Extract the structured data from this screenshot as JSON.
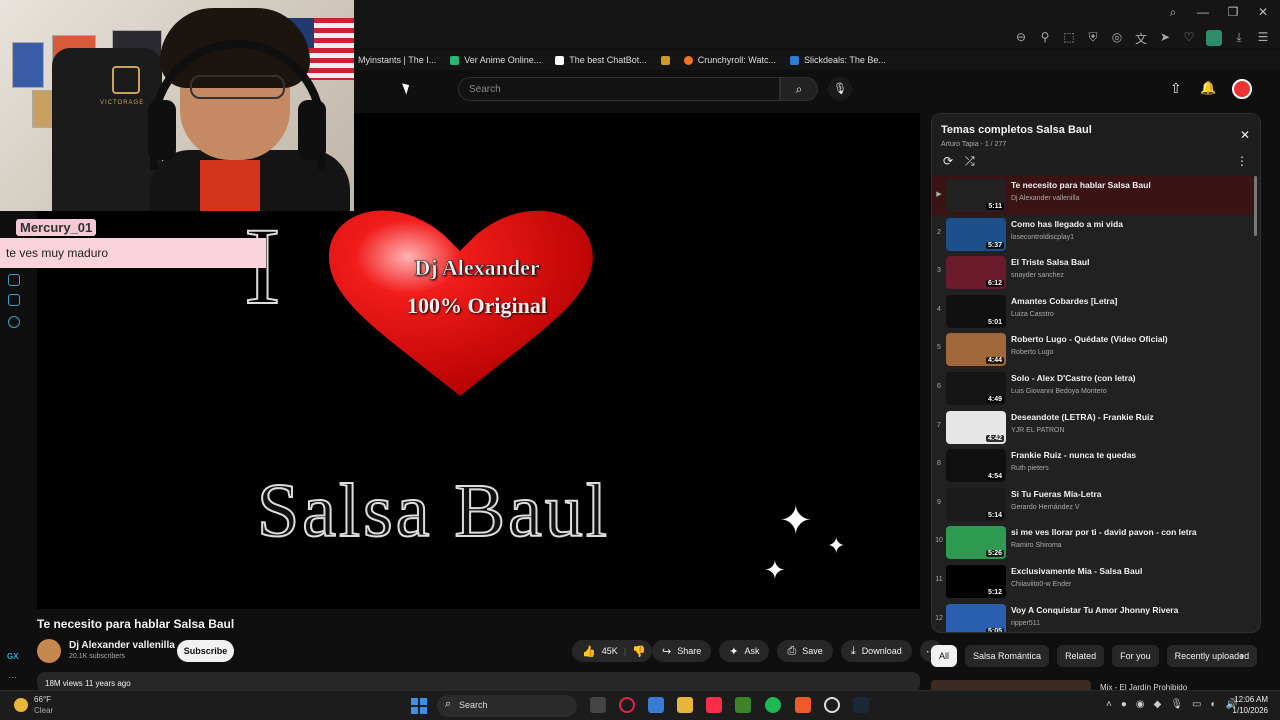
{
  "browser": {
    "bookmarks": [
      {
        "label": "Myinstants | The I...",
        "color": "#7a7a7a"
      },
      {
        "label": "Ver Anime Online...",
        "color": "#2bb673"
      },
      {
        "label": "The best ChatBot...",
        "color": "#ffffff"
      },
      {
        "label": "",
        "color": "#cf9a27"
      },
      {
        "label": "Crunchyroll: Watc...",
        "color": "#f47521"
      },
      {
        "label": "Slickdeals: The Be...",
        "color": "#2f7bd6"
      }
    ]
  },
  "overlay": {
    "chat_user": "Mercury_01",
    "chat_message": "te ves muy maduro",
    "chair_brand": "VICTORAGE"
  },
  "masthead": {
    "search_placeholder": "Search"
  },
  "player": {
    "big_letter": "I",
    "heart_line1": "Dj Alexander",
    "heart_line2": "100% Original",
    "main_text": "Salsa Baul"
  },
  "video": {
    "title": "Te necesito para hablar Salsa Baul",
    "channel": "Dj Alexander vallenilla",
    "subscribers": "20.1K subscribers",
    "subscribe_label": "Subscribe",
    "likes": "45K",
    "share_label": "Share",
    "ask_label": "Ask",
    "save_label": "Save",
    "download_label": "Download",
    "views_date": "18M views  11 years ago"
  },
  "playlist": {
    "title": "Temas completos Salsa Baul",
    "subtitle": "Arturo Tapia - 1 / 277",
    "items": [
      {
        "idx": "▶",
        "title": "Te necesito para hablar Salsa Baul",
        "channel": "Dj Alexander vallenilla",
        "duration": "5:11",
        "thumb": "#222"
      },
      {
        "idx": "2",
        "title": "Como has llegado a mi vida",
        "channel": "losecontroldiscplay1",
        "duration": "5:37",
        "thumb": "#1d4f8a"
      },
      {
        "idx": "3",
        "title": "El Triste Salsa Baul",
        "channel": "snayder sanchez",
        "duration": "6:12",
        "thumb": "#6a1a2a"
      },
      {
        "idx": "4",
        "title": "Amantes Cobardes [Letra]",
        "channel": "Luiza Casstro",
        "duration": "5:01",
        "thumb": "#111"
      },
      {
        "idx": "5",
        "title": "Roberto Lugo - Quédate (Video Oficial)",
        "channel": "Roberto Lugo",
        "duration": "4:44",
        "thumb": "#a0683a"
      },
      {
        "idx": "6",
        "title": "Solo - Alex D'Castro (con letra)",
        "channel": "Luis Giovanni Bedoya Montero",
        "duration": "4:49",
        "thumb": "#151515"
      },
      {
        "idx": "7",
        "title": "Deseandote (LETRA) - Frankie Ruiz",
        "channel": "YJR EL PATRON",
        "duration": "4:42",
        "thumb": "#e6e6e6"
      },
      {
        "idx": "8",
        "title": "Frankie Ruiz - nunca te quedas",
        "channel": "Ruth pieters",
        "duration": "4:54",
        "thumb": "#101010"
      },
      {
        "idx": "9",
        "title": "Si Tu Fueras Mía-Letra",
        "channel": "Gerardo Hernández V",
        "duration": "5:14",
        "thumb": "#1a1a1a"
      },
      {
        "idx": "10",
        "title": "si me ves llorar por ti - david pavon - con letra",
        "channel": "Ramiro Shiroma",
        "duration": "5:26",
        "thumb": "#2f9a52"
      },
      {
        "idx": "11",
        "title": "Exclusivamente Mia - Salsa Baul",
        "channel": "Chiiaviito0-w Ender",
        "duration": "5:12",
        "thumb": "#000"
      },
      {
        "idx": "12",
        "title": "Voy A Conquistar Tu Amor Jhonny Rivera",
        "channel": "ripper511",
        "duration": "5:05",
        "thumb": "#2a5fb0"
      }
    ]
  },
  "chips": [
    "All",
    "Salsa Romántica",
    "Related",
    "For you",
    "Recently uploaded"
  ],
  "next_rec_title": "Mix - El Jardín Prohibido",
  "taskbar": {
    "temp": "66°F",
    "weather": "Clear",
    "search": "Search",
    "time": "12:06 AM",
    "date": "1/10/2026"
  }
}
